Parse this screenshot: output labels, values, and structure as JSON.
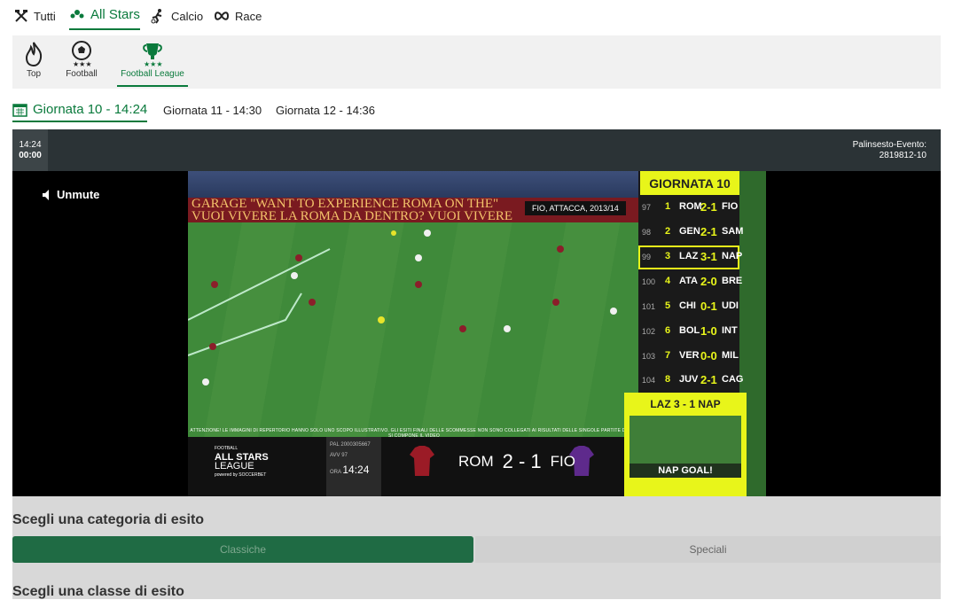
{
  "nav": {
    "items": [
      {
        "label": "Tutti",
        "icon": "tools-icon"
      },
      {
        "label": "All Stars",
        "icon": "stars-icon",
        "active": true
      },
      {
        "label": "Calcio",
        "icon": "runner-icon"
      },
      {
        "label": "Race",
        "icon": "infinity-icon"
      }
    ]
  },
  "subnav": {
    "items": [
      {
        "label": "Top",
        "icon": "flame-icon"
      },
      {
        "label": "Football",
        "icon": "football-icon"
      },
      {
        "label": "Football League",
        "icon": "trophy-icon",
        "active": true
      }
    ]
  },
  "rounds": {
    "items": [
      {
        "label": "Giornata 10 - 14:24",
        "active": true
      },
      {
        "label": "Giornata 11 - 14:30"
      },
      {
        "label": "Giornata 12 - 14:36"
      }
    ]
  },
  "player": {
    "clock_time": "14:24",
    "clock_countdown": "00:00",
    "palinsesto_label": "Palinsesto-Evento:",
    "palinsesto_value": "2819812-10",
    "unmute_label": "Unmute",
    "video": {
      "ad_line": "GARAGE \"WANT TO EXPERIENCE ROMA ON THE\"",
      "ad_line2": "VUOI VIVERE LA ROMA DA DENTRO? VUOI VIVERE",
      "caption": "FIO, ATTACCA, 2013/14",
      "disclaimer": "ATTENZIONE! LE IMMAGINI DI REPERTORIO HANNO SOLO UNO SCOPO ILLUSTRATIVO. GLI ESITI FINALI DELLE SCOMMESSE NON SONO COLLEGATI AI RISULTATI DELLE SINGOLE PARTITE DA CUI SI COMPONE IL VIDEO",
      "logo_top": "FOOTBALL",
      "logo_main": "ALL STARS",
      "logo_sub": "LEAGUE",
      "logo_powered": "powered by SOCCERBET",
      "meta_pal_label": "PAL",
      "meta_pal_value": "2000305667",
      "meta_avv_label": "AVV",
      "meta_avv_value": "97",
      "meta_ora_label": "ORA",
      "meta_ora_value": "14:24",
      "home": "ROM",
      "score": "2 - 1",
      "away": "FIO",
      "home_color": "#9b1b26",
      "away_color": "#5e2a8c"
    },
    "board": {
      "title": "GIORNATA 10",
      "rows": [
        {
          "num": "97",
          "pos": "1",
          "home": "ROM",
          "score": "2-1",
          "away": "FIO"
        },
        {
          "num": "98",
          "pos": "2",
          "home": "GEN",
          "score": "2-1",
          "away": "SAM"
        },
        {
          "num": "99",
          "pos": "3",
          "home": "LAZ",
          "score": "3-1",
          "away": "NAP",
          "highlight": true
        },
        {
          "num": "100",
          "pos": "4",
          "home": "ATA",
          "score": "2-0",
          "away": "BRE"
        },
        {
          "num": "101",
          "pos": "5",
          "home": "CHI",
          "score": "0-1",
          "away": "UDI"
        },
        {
          "num": "102",
          "pos": "6",
          "home": "BOL",
          "score": "1-0",
          "away": "INT"
        },
        {
          "num": "103",
          "pos": "7",
          "home": "VER",
          "score": "0-0",
          "away": "MIL"
        },
        {
          "num": "104",
          "pos": "8",
          "home": "JUV",
          "score": "2-1",
          "away": "CAG"
        }
      ]
    },
    "goal": {
      "title": "LAZ  3 - 1  NAP",
      "label": "NAP GOAL!"
    }
  },
  "sections": {
    "categoria_title": "Scegli una categoria di esito",
    "classiche": "Classiche",
    "speciali": "Speciali",
    "classe_title": "Scegli una classe di esito"
  },
  "colors": {
    "accent": "#0a7a3c",
    "board_yellow": "#e8f51a"
  }
}
